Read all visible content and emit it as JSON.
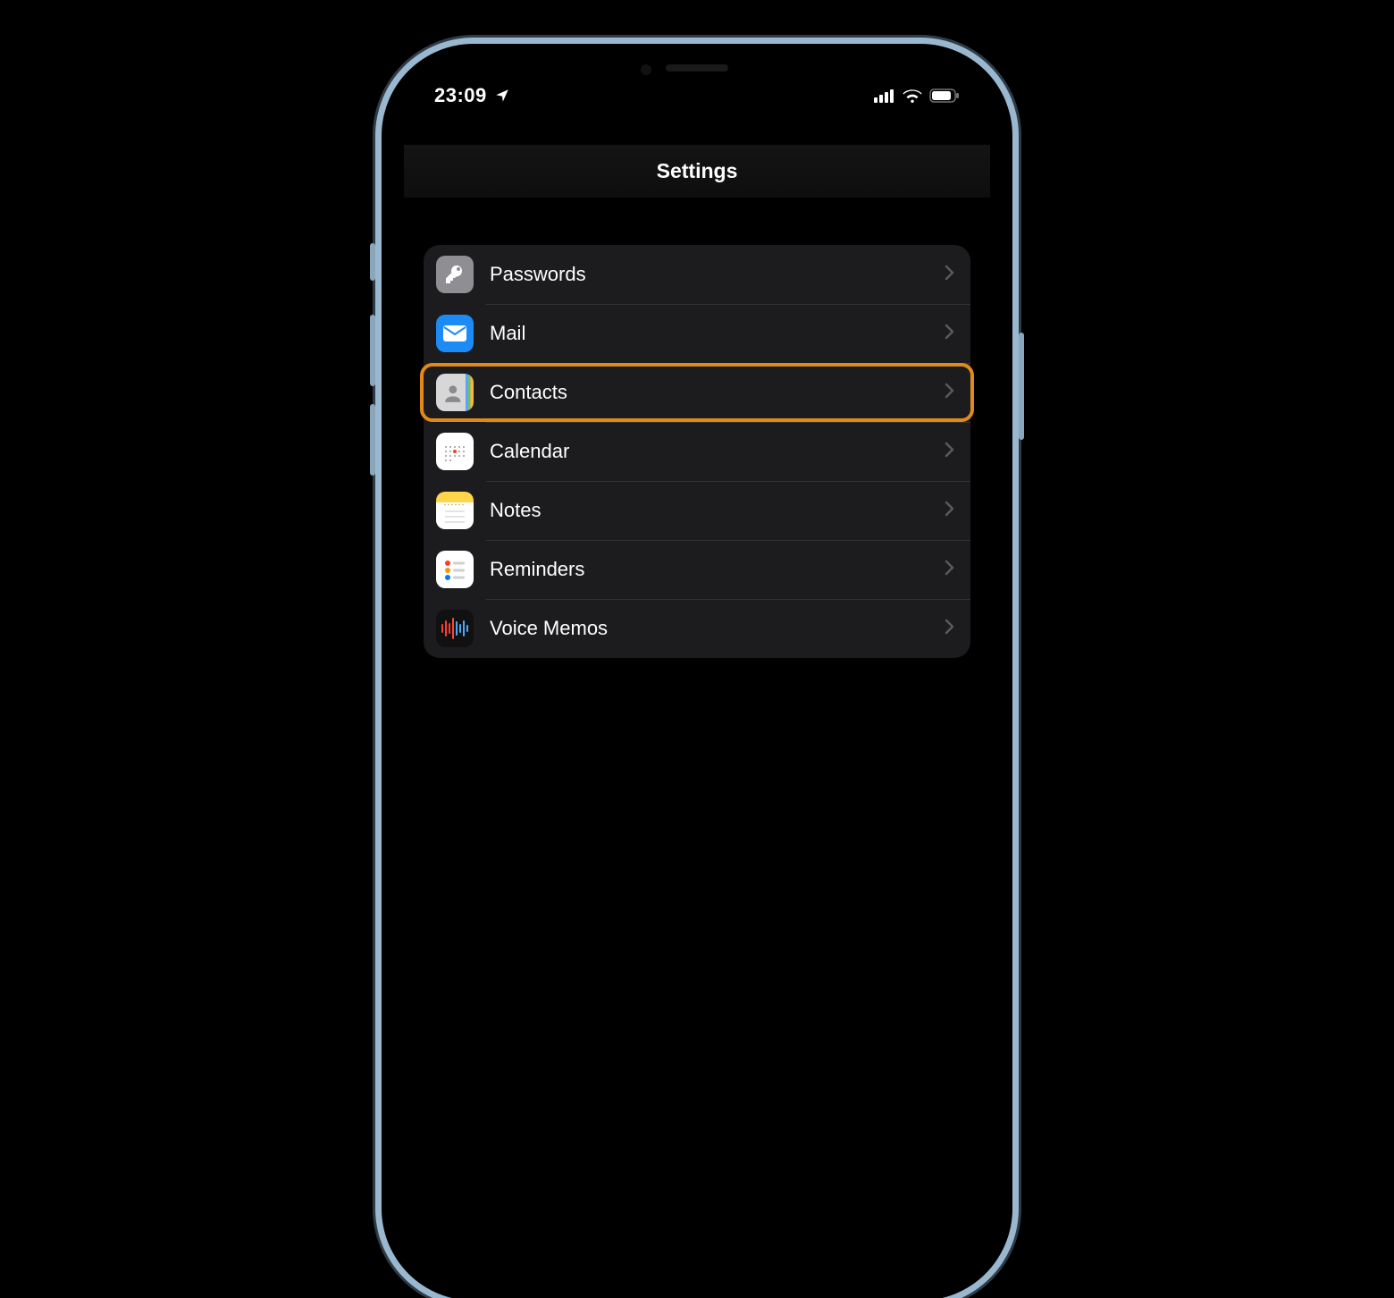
{
  "statusbar": {
    "time": "23:09"
  },
  "nav": {
    "title": "Settings"
  },
  "list": {
    "items": [
      {
        "id": "passwords",
        "label": "Passwords",
        "highlight": false
      },
      {
        "id": "mail",
        "label": "Mail",
        "highlight": false
      },
      {
        "id": "contacts",
        "label": "Contacts",
        "highlight": true
      },
      {
        "id": "calendar",
        "label": "Calendar",
        "highlight": false
      },
      {
        "id": "notes",
        "label": "Notes",
        "highlight": false
      },
      {
        "id": "reminders",
        "label": "Reminders",
        "highlight": false
      },
      {
        "id": "voicememos",
        "label": "Voice Memos",
        "highlight": false
      }
    ]
  }
}
